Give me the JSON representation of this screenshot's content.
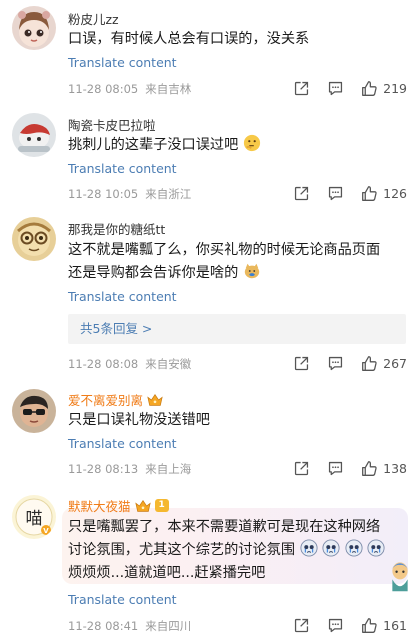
{
  "translate_label": "Translate content",
  "comments": [
    {
      "username": "粉皮儿zz",
      "text": "口误，有时候人总会有口误的，没关系",
      "date": "11-28 08:05",
      "location": "来自吉林",
      "likes": "219"
    },
    {
      "username": "陶瓷卡皮巴拉啦",
      "text": "挑刺儿的这辈子没口误过吧",
      "date": "11-28 10:05",
      "location": "来自浙江",
      "likes": "126"
    },
    {
      "username": "那我是你的糖纸tt",
      "text_line1": "这不就是嘴瓢了么，你买礼物的时候无论商品页面",
      "text_line2": "还是导购都会告诉你是啥的",
      "replies_label": "共5条回复 >",
      "date": "11-28 08:08",
      "location": "来自安徽",
      "likes": "267"
    },
    {
      "username": "爱不离爱别离",
      "text": "只是口误礼物没送错吧",
      "date": "11-28 08:13",
      "location": "来自上海",
      "likes": "138"
    },
    {
      "username": "默默大夜猫",
      "level": "1",
      "text_line1": "只是嘴瓢罢了，本来不需要道歉可是现在这种网络",
      "text_line2": "讨论氛围，尤其这个综艺的讨论氛围",
      "text_line3": "烦烦烦...道就道吧...赶紧播完吧",
      "date": "11-28 08:41",
      "location": "来自四川",
      "likes": "161"
    }
  ],
  "icons": {
    "share": "share-icon",
    "reply": "comment-icon",
    "like": "thumbs-up-icon"
  }
}
